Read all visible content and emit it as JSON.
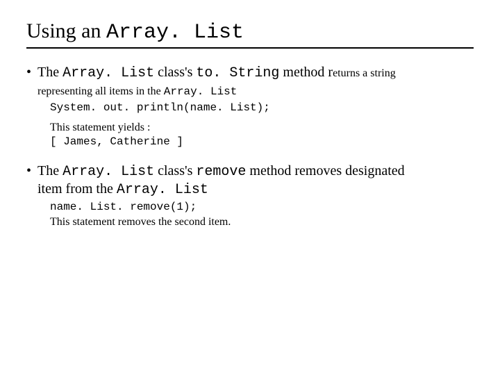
{
  "title_prefix": "Using an ",
  "title_code": "Array. List",
  "b1": {
    "t1": "The ",
    "c1": "Array. List",
    "t2": " class's ",
    "c2": "to. String",
    "t3": " method r",
    "t4": "eturns a string",
    "t5": "representing all items in the ",
    "c3": "Array. List"
  },
  "code1": "System. out. println(name. List);",
  "yield_label": "This statement yields :",
  "yield_output": "[ James, Catherine ]",
  "b2": {
    "t1": "The ",
    "c1": "Array. List",
    "t2": " class's ",
    "c2": "remove",
    "t3": " method removes designated",
    "t4": "item from the ",
    "c3": "Array. List"
  },
  "code2": "name. List. remove(1);",
  "note2": "This statement removes the second item."
}
